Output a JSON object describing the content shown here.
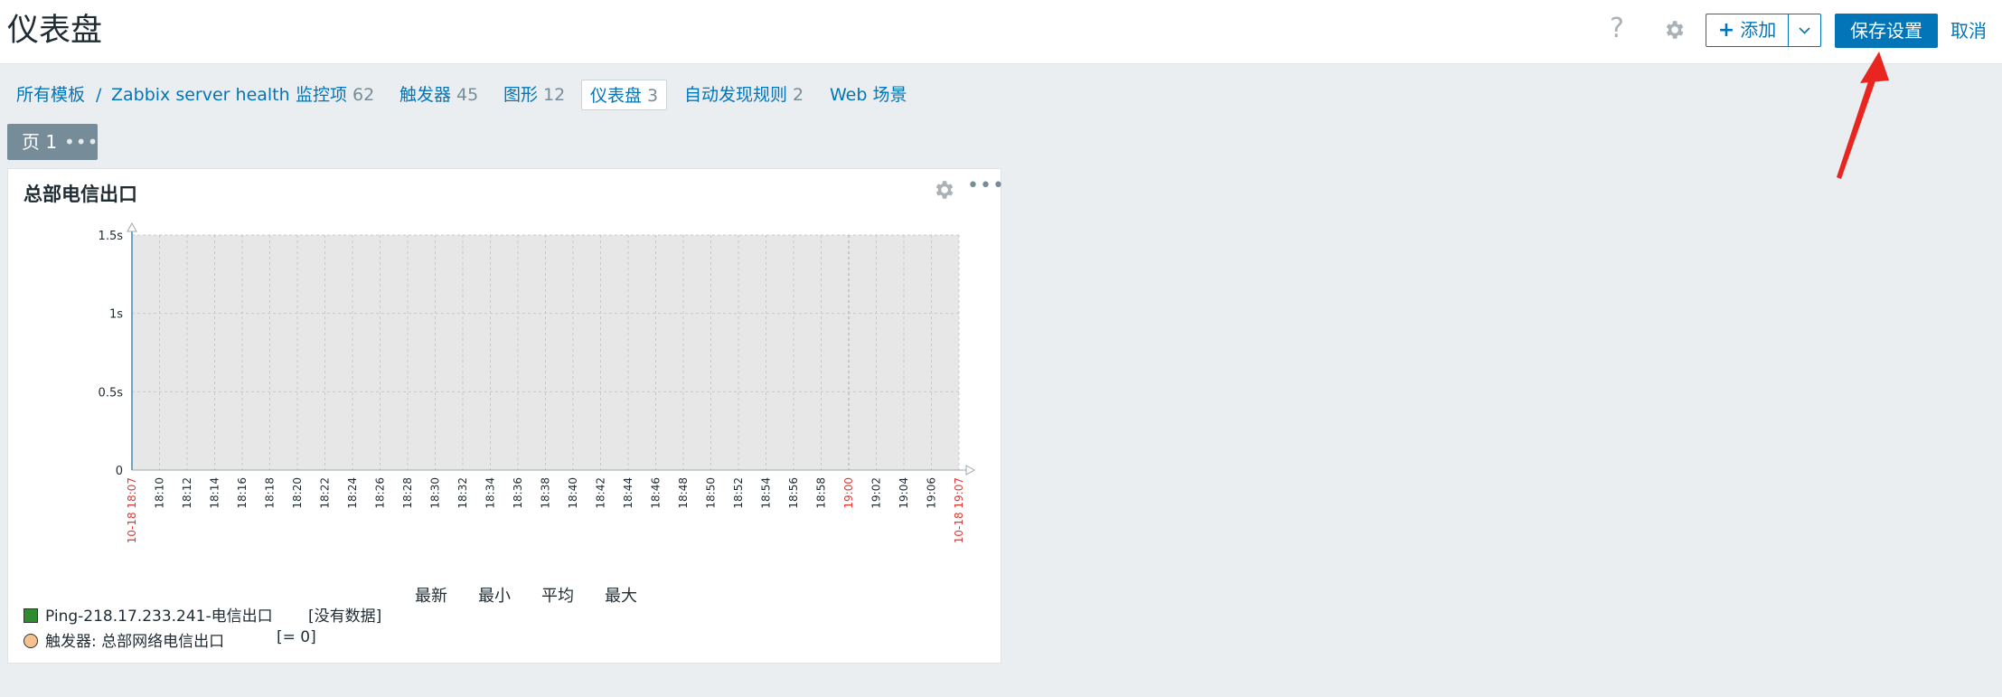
{
  "header": {
    "title": "仪表盘",
    "help_icon": "?",
    "add_label": "添加",
    "add_icon": "plus-icon",
    "save_label": "保存设置",
    "cancel_label": "取消"
  },
  "breadcrumb": {
    "all_templates": "所有模板",
    "separator": "/",
    "host": "Zabbix server health",
    "items": {
      "label": "监控项",
      "count": "62"
    },
    "triggers": {
      "label": "触发器",
      "count": "45"
    },
    "graphs": {
      "label": "图形",
      "count": "12"
    },
    "dashboards": {
      "label": "仪表盘",
      "count": "3"
    },
    "discovery": {
      "label": "自动发现规则",
      "count": "2"
    },
    "web": {
      "label": "Web 场景"
    }
  },
  "page_tab": {
    "label": "页 1"
  },
  "widget": {
    "title": "总部电信出口",
    "legend_headers": [
      "最新",
      "最小",
      "平均",
      "最大"
    ],
    "legend_items": [
      {
        "name": "Ping-218.17.233.241-电信出口",
        "value": "[没有数据]",
        "color": "#2e8b2e"
      },
      {
        "name": "触发器: 总部网络电信出口",
        "value": "[= 0]",
        "color": "#f5c28e"
      }
    ]
  },
  "chart_data": {
    "type": "line",
    "y_ticks": [
      "0",
      "0.5s",
      "1s",
      "1.5s"
    ],
    "ylim": [
      0,
      1.5
    ],
    "x_ticks": [
      "10-18 18:07",
      "18:10",
      "18:12",
      "18:14",
      "18:16",
      "18:18",
      "18:20",
      "18:22",
      "18:24",
      "18:26",
      "18:28",
      "18:30",
      "18:32",
      "18:34",
      "18:36",
      "18:38",
      "18:40",
      "18:42",
      "18:44",
      "18:46",
      "18:48",
      "18:50",
      "18:52",
      "18:54",
      "18:56",
      "18:58",
      "19:00",
      "19:02",
      "19:04",
      "19:06",
      "10-18 19:07"
    ],
    "highlight_ticks": [
      "10-18 18:07",
      "19:00",
      "10-18 19:07"
    ],
    "series": [],
    "grid": true,
    "colors": {
      "plot_bg": "#e7e7e7",
      "grid": "#c8c8c8",
      "highlight": "#e33734",
      "tick": "#1f2c33"
    }
  },
  "annotation": {
    "color": "#e8261f"
  }
}
